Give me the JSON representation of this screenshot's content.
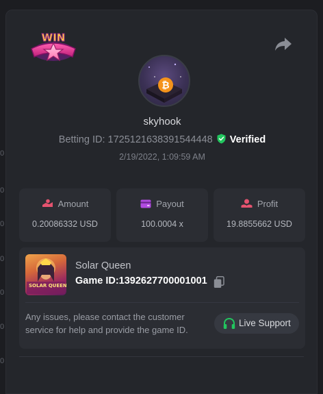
{
  "header": {
    "logo_text": "WIN",
    "share_icon": "share-icon"
  },
  "bet": {
    "username": "skyhook",
    "betting_id_label": "Betting ID:",
    "betting_id": "1725121638391544448",
    "verified_label": "Verified",
    "timestamp": "2/19/2022, 1:09:59 AM"
  },
  "stats": [
    {
      "label": "Amount",
      "value": "0.20086332 USD",
      "icon": "amount-icon"
    },
    {
      "label": "Payout",
      "value": "100.0004 x",
      "icon": "payout-card-icon"
    },
    {
      "label": "Profit",
      "value": "19.8855662 USD",
      "icon": "profit-icon"
    }
  ],
  "game": {
    "name": "Solar Queen",
    "id_label": "Game ID:",
    "id_value": "1392627700001001",
    "thumb_text": "SOLAR QUEEN",
    "help_text": "Any issues, please contact the customer service for help and provide the game ID.",
    "support_label": "Live Support"
  },
  "colors": {
    "background": "#1c1d21",
    "panel": "#24262b",
    "card": "#2b2d33",
    "verified_green": "#22c55e",
    "stat_icon_pink": "#e5536f",
    "payout_purple": "#b14be0",
    "support_green": "#22c55e"
  }
}
